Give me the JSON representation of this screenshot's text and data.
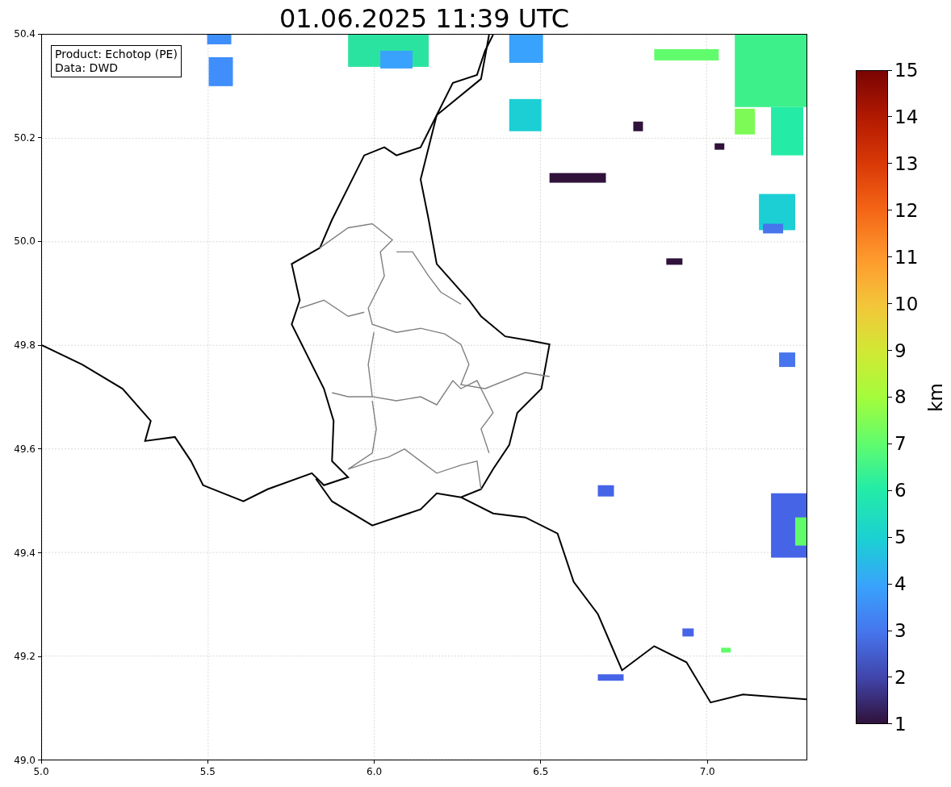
{
  "title": "01.06.2025 11:39 UTC",
  "plot": {
    "x_axis": {
      "ticks": [
        "5.0",
        "5.5",
        "6.0",
        "6.5",
        "7.0"
      ]
    },
    "y_axis": {
      "ticks": [
        "50.4",
        "50.2",
        "50.0",
        "49.8",
        "49.6",
        "49.4",
        "49.2",
        "49.0"
      ]
    },
    "info_box": {
      "lines": [
        "Product: Echotop (PE)",
        "Data: DWD"
      ]
    }
  },
  "colorbar": {
    "label": "km",
    "ticks": [
      "15",
      "14",
      "13",
      "12",
      "11",
      "10",
      "9",
      "8",
      "7",
      "6",
      "5",
      "4",
      "3",
      "2",
      "1"
    ]
  }
}
